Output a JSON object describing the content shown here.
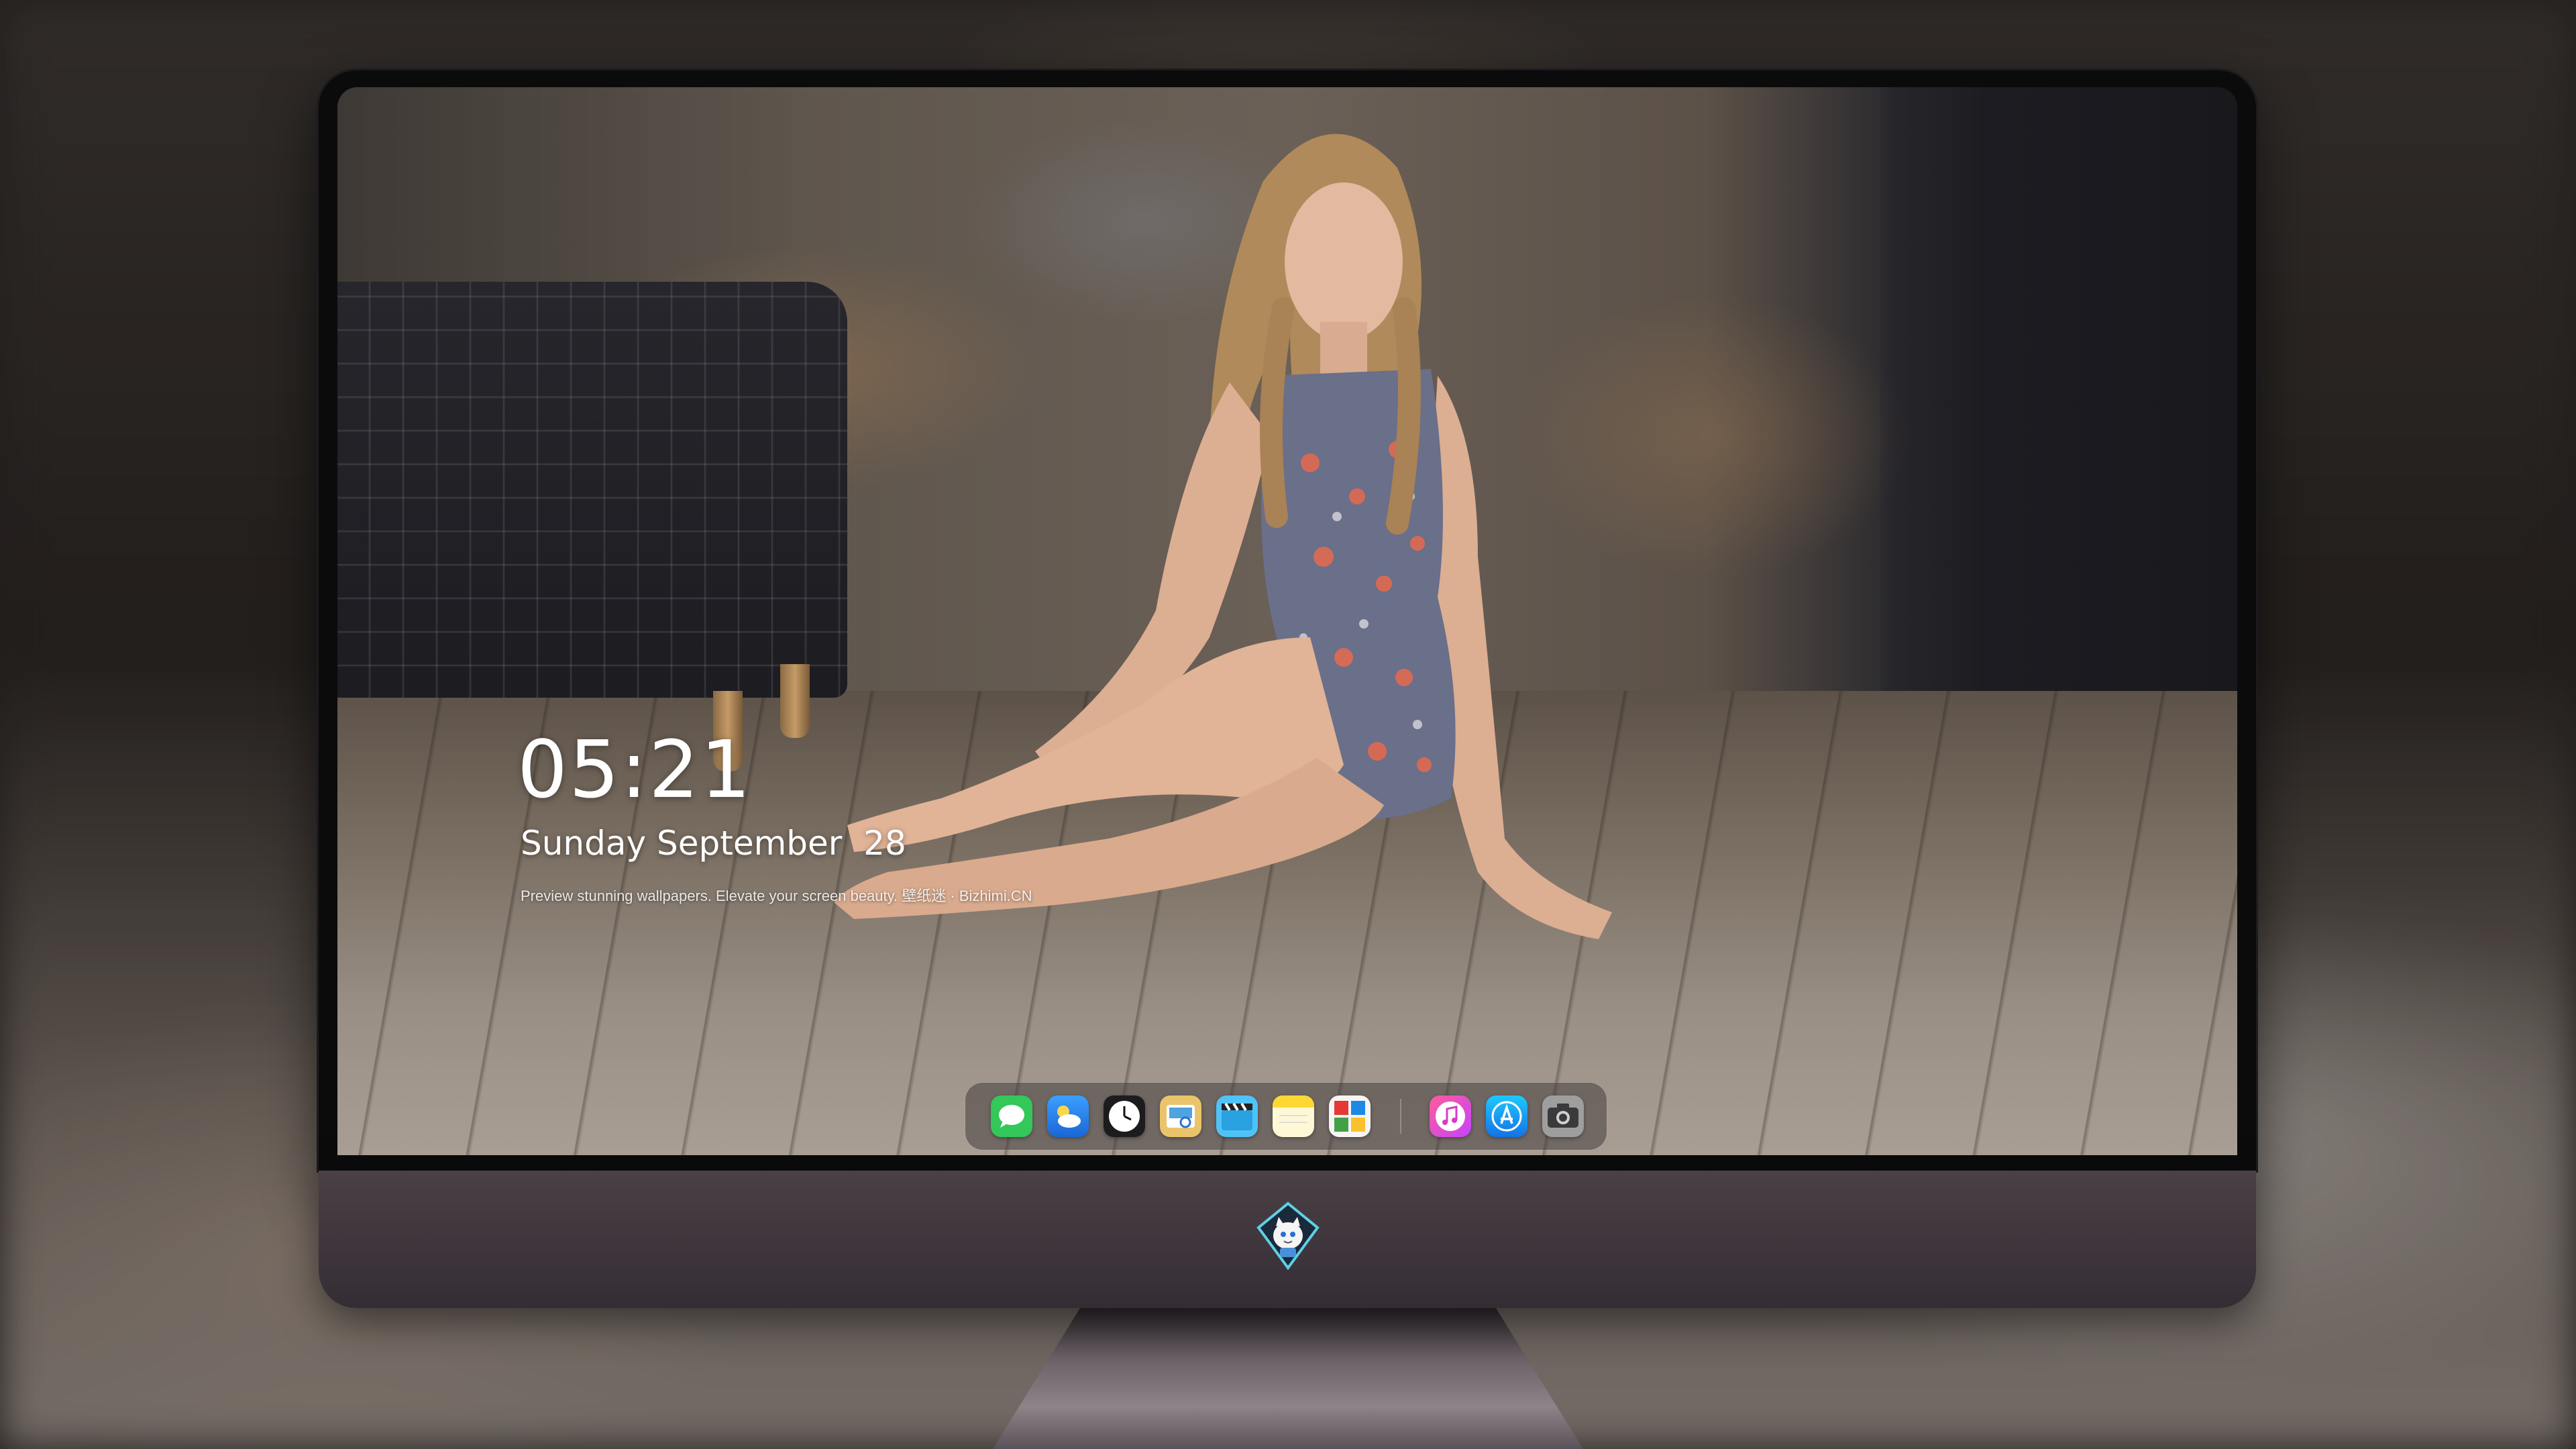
{
  "lockscreen": {
    "time": "05:21",
    "date": "Sunday September  28",
    "tagline": "Preview stunning wallpapers. Elevate your screen beauty. 壁纸迷 · Bizhimi.CN"
  },
  "dock": {
    "apps": [
      {
        "name": "messages",
        "icon": "messages-icon",
        "color": "#34c759"
      },
      {
        "name": "weather",
        "icon": "weather-icon",
        "color": "#2a8cf0"
      },
      {
        "name": "clock",
        "icon": "clock-icon",
        "color": "#1c1c1e"
      },
      {
        "name": "preview",
        "icon": "preview-icon",
        "color": "#e9c46a"
      },
      {
        "name": "clips",
        "icon": "clips-icon",
        "color": "#4fc3f7"
      },
      {
        "name": "notes",
        "icon": "notes-icon",
        "color": "#fdd835"
      },
      {
        "name": "photo-booth",
        "icon": "photo-booth-icon",
        "color": "#66bb6a"
      },
      {
        "name": "itunes",
        "icon": "itunes-icon",
        "color": "#e040fb"
      },
      {
        "name": "app-store",
        "icon": "app-store-icon",
        "color": "#1e88e5"
      },
      {
        "name": "camera",
        "icon": "camera-icon",
        "color": "#9e9e9e"
      }
    ]
  },
  "monitor": {
    "logo_icon": "cat-mascot-logo-icon"
  }
}
